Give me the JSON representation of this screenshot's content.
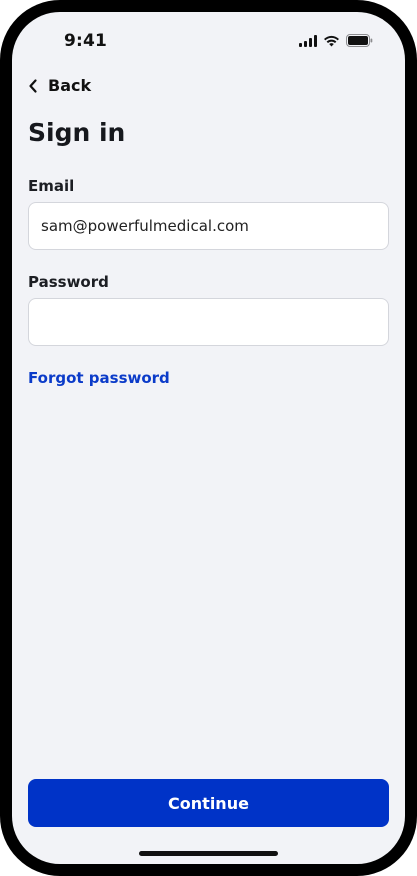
{
  "status_bar": {
    "time": "9:41",
    "icons": [
      "cellular-signal-icon",
      "wifi-icon",
      "battery-icon"
    ]
  },
  "nav": {
    "back_label": "Back",
    "back_icon": "chevron-left-icon"
  },
  "page": {
    "title": "Sign in"
  },
  "form": {
    "email": {
      "label": "Email",
      "value": "sam@powerfulmedical.com"
    },
    "password": {
      "label": "Password",
      "value": ""
    },
    "forgot_password_label": "Forgot password"
  },
  "actions": {
    "continue_label": "Continue"
  },
  "colors": {
    "primary": "#0033c7",
    "link": "#0b3bc9",
    "background": "#f2f3f7",
    "input_border": "#d4d6dc"
  }
}
